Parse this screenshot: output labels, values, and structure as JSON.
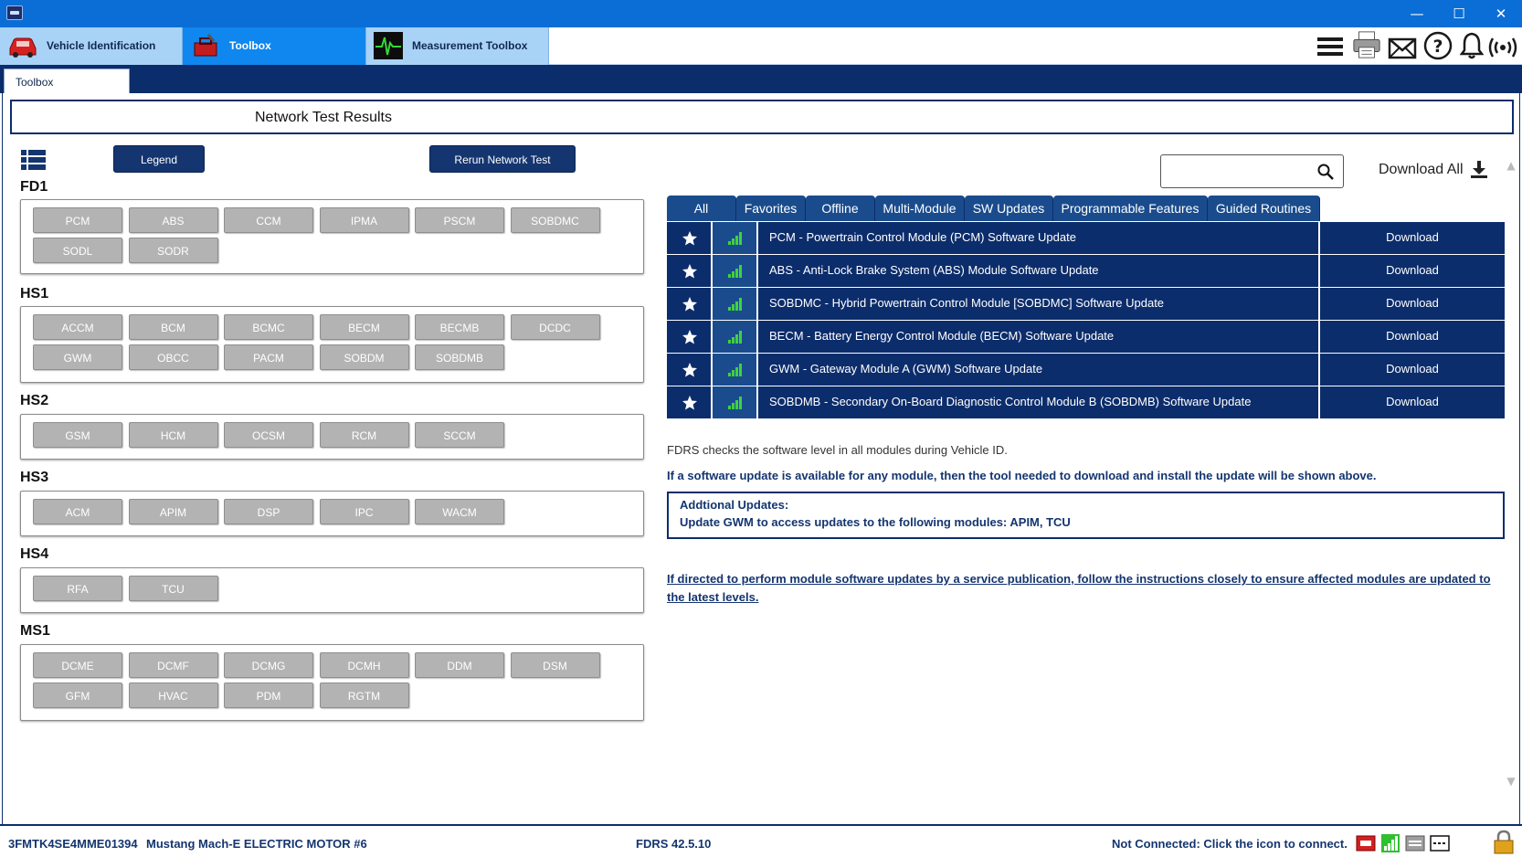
{
  "window": {
    "minimize": "—",
    "maximize": "☐",
    "close": "✕"
  },
  "main_tabs": [
    {
      "label": "Vehicle Identification",
      "icon": "car-icon"
    },
    {
      "label": "Toolbox",
      "icon": "toolbox-icon",
      "active": true
    },
    {
      "label": "Measurement Toolbox",
      "icon": "oscilloscope-icon"
    }
  ],
  "toolbar_icons": [
    "menu-icon",
    "printer-icon",
    "mail-icon",
    "help-icon",
    "bell-icon",
    "wireless-icon"
  ],
  "sub_tab": "Toolbox",
  "header_title": "Network Test Results",
  "buttons": {
    "legend": "Legend",
    "rerun": "Rerun Network Test"
  },
  "networks": [
    {
      "name": "FD1",
      "modules": [
        "PCM",
        "ABS",
        "CCM",
        "IPMA",
        "PSCM",
        "SOBDMC",
        "SODL",
        "SODR"
      ]
    },
    {
      "name": "HS1",
      "modules": [
        "ACCM",
        "BCM",
        "BCMC",
        "BECM",
        "BECMB",
        "DCDC",
        "GWM",
        "OBCC",
        "PACM",
        "SOBDM",
        "SOBDMB"
      ]
    },
    {
      "name": "HS2",
      "modules": [
        "GSM",
        "HCM",
        "OCSM",
        "RCM",
        "SCCM"
      ]
    },
    {
      "name": "HS3",
      "modules": [
        "ACM",
        "APIM",
        "DSP",
        "IPC",
        "WACM"
      ]
    },
    {
      "name": "HS4",
      "modules": [
        "RFA",
        "TCU"
      ]
    },
    {
      "name": "MS1",
      "modules": [
        "DCME",
        "DCMF",
        "DCMG",
        "DCMH",
        "DDM",
        "DSM",
        "GFM",
        "HVAC",
        "PDM",
        "RGTM"
      ]
    }
  ],
  "search": {
    "placeholder": "",
    "value": ""
  },
  "download_all": "Download All",
  "filter_tabs": [
    "All",
    "Favorites",
    "Offline",
    "Multi-Module",
    "SW Updates",
    "Programmable Features",
    "Guided Routines"
  ],
  "updates": [
    {
      "name": "PCM - Powertrain Control Module (PCM) Software Update",
      "action": "Download"
    },
    {
      "name": "ABS - Anti-Lock Brake System (ABS) Module Software Update",
      "action": "Download"
    },
    {
      "name": "SOBDMC - Hybrid Powertrain Control Module [SOBDMC] Software Update",
      "action": "Download"
    },
    {
      "name": "BECM - Battery Energy Control Module (BECM) Software Update",
      "action": "Download"
    },
    {
      "name": "GWM - Gateway Module A (GWM) Software Update",
      "action": "Download"
    },
    {
      "name": "SOBDMB - Secondary On-Board Diagnostic Control Module B (SOBDMB) Software Update",
      "action": "Download"
    }
  ],
  "notes": {
    "check": "FDRS checks the software level in all modules during Vehicle ID.",
    "available": "If a software update is available for any module, then the tool needed to download and install the update will be shown above.",
    "additional_title": "Addtional Updates:",
    "additional_body": "Update GWM to access updates to the following modules: APIM, TCU",
    "link": "If directed to perform module software updates by a service publication, follow the instructions closely to ensure affected modules are updated to the latest levels."
  },
  "status": {
    "vin": "3FMTK4SE4MME01394",
    "vehicle": "Mustang Mach-E ELECTRIC MOTOR #6",
    "version": "FDRS 42.5.10",
    "connection": "Not Connected: Click the icon to connect."
  },
  "colors": {
    "navy": "#0c2d6b",
    "tab_blue": "#1a4c8d",
    "active_tab": "#0f87ee",
    "module_grey": "#b3b3b3",
    "signal_green": "#3fd13f"
  }
}
